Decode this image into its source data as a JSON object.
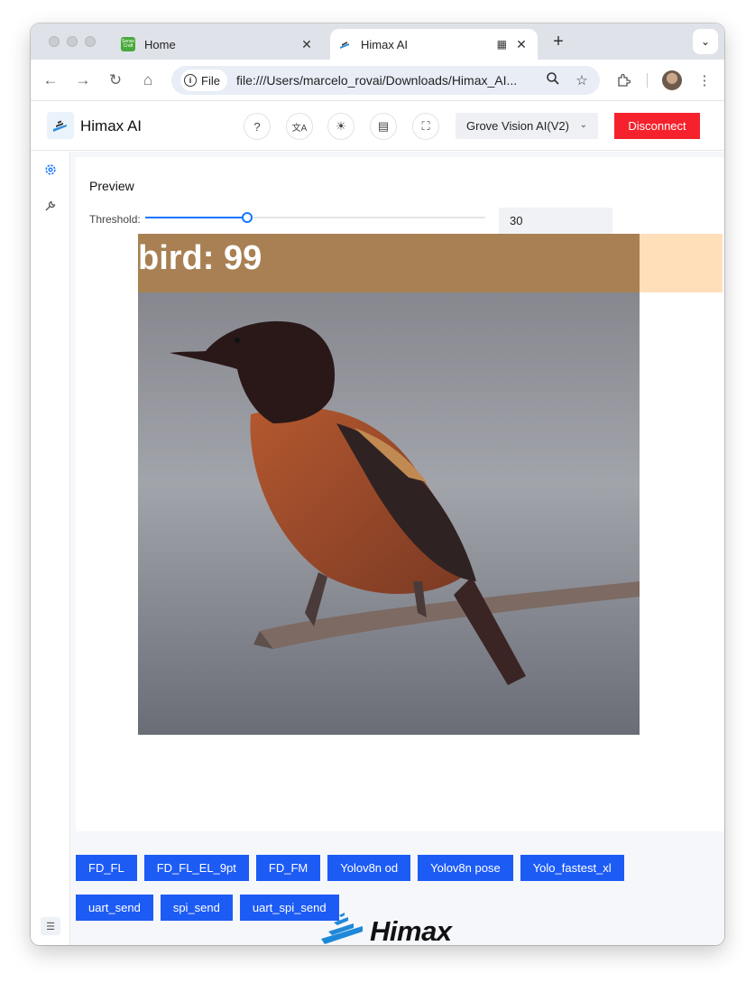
{
  "browser": {
    "tabs": [
      {
        "title": "Home",
        "favicon_text": "Sense Craft"
      },
      {
        "title": "Himax AI"
      }
    ],
    "address": {
      "scheme_chip": "File",
      "url": "file:///Users/marcelo_rovai/Downloads/Himax_AI..."
    }
  },
  "app": {
    "title": "Himax AI",
    "header_buttons": {
      "help": "?",
      "translate": "文A",
      "theme": "☀",
      "doc": "▤",
      "fullscreen": "⛶"
    },
    "device": "Grove Vision AI(V2)",
    "disconnect_label": "Disconnect"
  },
  "preview": {
    "title": "Preview",
    "threshold_label": "Threshold:",
    "threshold_value": "30",
    "threshold_fraction": 0.3,
    "detection_label": "bird: 99"
  },
  "model_buttons": [
    "FD_FL",
    "FD_FL_EL_9pt",
    "FD_FM",
    "Yolov8n od",
    "Yolov8n pose",
    "Yolo_fastest_xl"
  ],
  "send_buttons": [
    "uart_send",
    "spi_send",
    "uart_spi_send"
  ],
  "footer": {
    "logo_text": "Himax"
  },
  "colors": {
    "accent": "#1677ff",
    "primary_button": "#1d5bf5",
    "danger": "#f5222d",
    "label_bg": "#ab804e",
    "label_bg_right": "#ffdfba"
  }
}
